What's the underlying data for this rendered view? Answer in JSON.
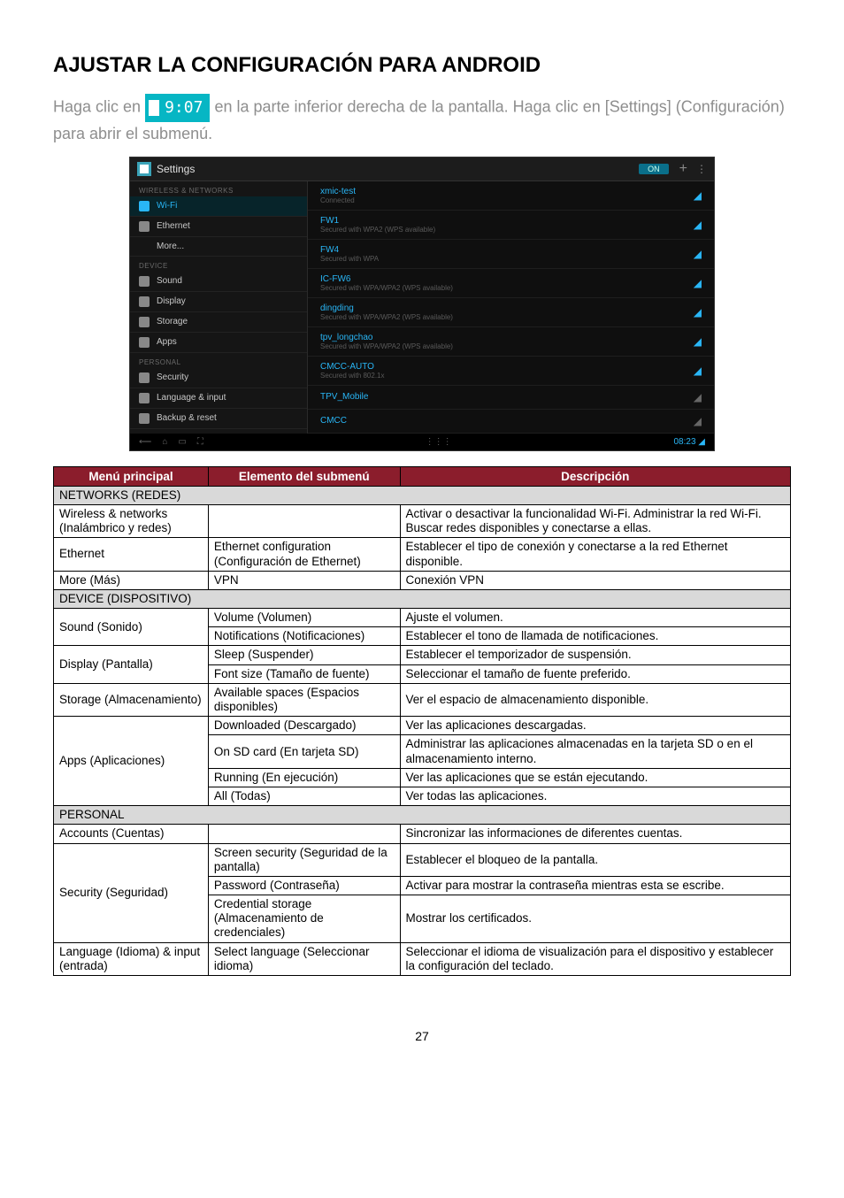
{
  "page_title": "AJUSTAR LA CONFIGURACIÓN PARA ANDROID",
  "intro_part1": "Haga clic en ",
  "time_badge": "9:07",
  "intro_part2": " en la parte inferior derecha de la pantalla. Haga clic en [Settings] (Configuración) para abrir el submenú.",
  "screenshot": {
    "title": "Settings",
    "on_label": "ON",
    "nav": {
      "section1": "WIRELESS & NETWORKS",
      "wifi": "Wi-Fi",
      "ethernet": "Ethernet",
      "more": "More...",
      "section2": "DEVICE",
      "sound": "Sound",
      "display": "Display",
      "storage": "Storage",
      "apps": "Apps",
      "section3": "PERSONAL",
      "security": "Security",
      "language": "Language & input",
      "backup": "Backup & reset"
    },
    "wifi_list": [
      {
        "name": "xmic-test",
        "sub": "Connected"
      },
      {
        "name": "FW1",
        "sub": "Secured with WPA2 (WPS available)"
      },
      {
        "name": "FW4",
        "sub": "Secured with WPA"
      },
      {
        "name": "IC-FW6",
        "sub": "Secured with WPA/WPA2 (WPS available)"
      },
      {
        "name": "dingding",
        "sub": "Secured with WPA/WPA2 (WPS available)"
      },
      {
        "name": "tpv_longchao",
        "sub": "Secured with WPA/WPA2 (WPS available)"
      },
      {
        "name": "CMCC-AUTO",
        "sub": "Secured with 802.1x"
      },
      {
        "name": "TPV_Mobile",
        "sub": ""
      },
      {
        "name": "CMCC",
        "sub": ""
      }
    ],
    "sysbar_time": "08:23"
  },
  "table_headers": {
    "c1": "Menú principal",
    "c2": "Elemento del submenú",
    "c3": "Descripción"
  },
  "sections": {
    "networks": "NETWORKS (REDES)",
    "device": "DEVICE (DISPOSITIVO)",
    "personal": "PERSONAL"
  },
  "rows": {
    "wireless_main": "Wireless & networks (Inalámbrico y redes)",
    "wireless_desc": "Activar o desactivar la funcionalidad Wi-Fi. Administrar la red Wi-Fi. Buscar redes disponibles y conectarse a ellas.",
    "ethernet_main": "Ethernet",
    "ethernet_sub": "Ethernet configuration (Configuración de Ethernet)",
    "ethernet_desc": "Establecer el tipo de conexión y conectarse a la red Ethernet disponible.",
    "more_main": "More (Más)",
    "more_sub": "VPN",
    "more_desc": "Conexión VPN",
    "sound_main": "Sound (Sonido)",
    "sound_sub1": "Volume (Volumen)",
    "sound_desc1": "Ajuste el volumen.",
    "sound_sub2": "Notifications (Notificaciones)",
    "sound_desc2": "Establecer el tono de llamada de notificaciones.",
    "display_main": "Display (Pantalla)",
    "display_sub1": "Sleep (Suspender)",
    "display_desc1": "Establecer el temporizador de suspensión.",
    "display_sub2": "Font size (Tamaño de fuente)",
    "display_desc2": "Seleccionar el tamaño de fuente preferido.",
    "storage_main": "Storage (Almacenamiento)",
    "storage_sub": "Available spaces (Espacios disponibles)",
    "storage_desc": "Ver el espacio de almacenamiento disponible.",
    "apps_main": "Apps (Aplicaciones)",
    "apps_sub1": "Downloaded (Descargado)",
    "apps_desc1": "Ver las aplicaciones descargadas.",
    "apps_sub2": "On SD card (En tarjeta SD)",
    "apps_desc2": "Administrar las aplicaciones almacenadas en la tarjeta SD o en el almacenamiento interno.",
    "apps_sub3": "Running (En ejecución)",
    "apps_desc3": "Ver las aplicaciones que se están ejecutando.",
    "apps_sub4": "All (Todas)",
    "apps_desc4": "Ver todas las aplicaciones.",
    "accounts_main": "Accounts (Cuentas)",
    "accounts_desc": "Sincronizar las informaciones de diferentes cuentas.",
    "security_main": "Security (Seguridad)",
    "security_sub1": "Screen security (Seguridad de la pantalla)",
    "security_desc1": "Establecer el bloqueo de la pantalla.",
    "security_sub2": "Password (Contraseña)",
    "security_desc2": "Activar para mostrar la contraseña mientras esta se escribe.",
    "security_sub3": "Credential storage (Almacenamiento de credenciales)",
    "security_desc3": "Mostrar los certificados.",
    "lang_main": "Language (Idioma) & input (entrada)",
    "lang_sub": "Select language (Seleccionar idioma)",
    "lang_desc": "Seleccionar el idioma de visualización para el dispositivo y establecer la configuración del teclado."
  },
  "page_number": "27"
}
